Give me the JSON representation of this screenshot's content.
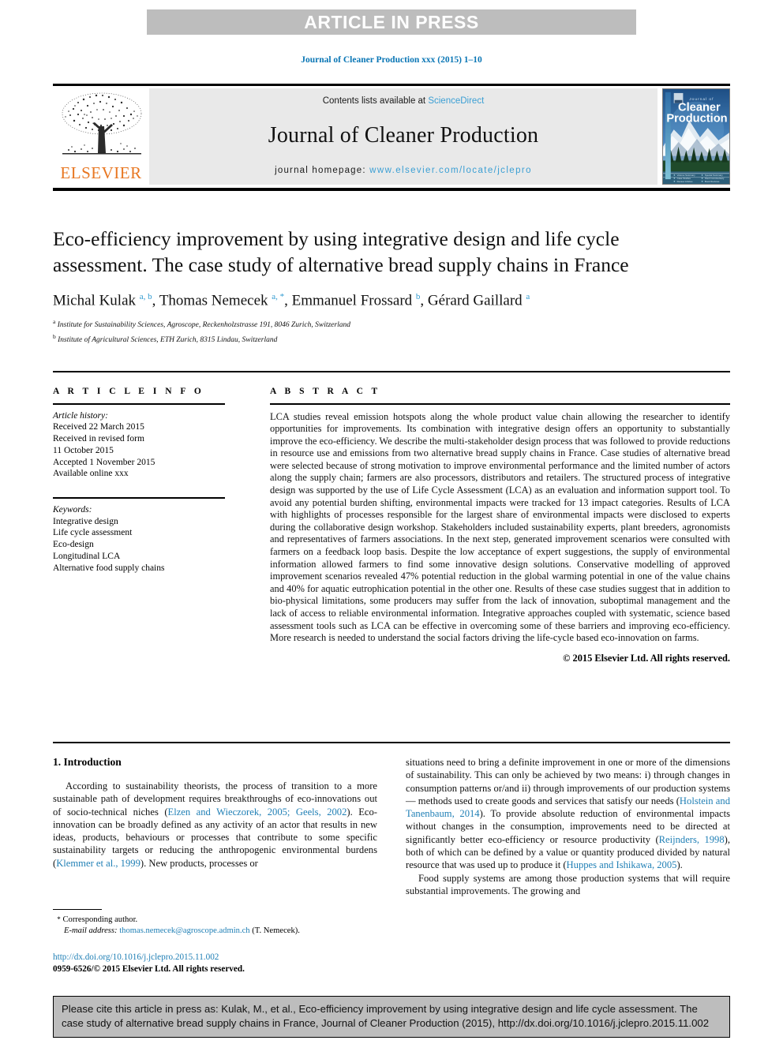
{
  "banner": {
    "text": "ARTICLE IN PRESS"
  },
  "running_head": "Journal of Cleaner Production xxx (2015) 1–10",
  "masthead": {
    "contents_prefix": "Contents lists available at ",
    "sciencedirect": "ScienceDirect",
    "journal_title": "Journal of Cleaner Production",
    "homepage_prefix": "journal homepage: ",
    "homepage_url": "www.elsevier.com/locate/jclepro",
    "publisher_logo_text": "ELSEVIER",
    "cover_title_small": "Journal of",
    "cover_title_line1": "Cleaner",
    "cover_title_line2": "Production",
    "accent_blue": "#3b9fd4",
    "elsevier_orange": "#e87722",
    "banner_grey": "#bdbdbd"
  },
  "article": {
    "title": "Eco-efficiency improvement by using integrative design and life cycle assessment. The case study of alternative bread supply chains in France",
    "authors_html": "Michal Kulak <sup>a, b</sup>, Thomas Nemecek <sup>a, *</sup>, Emmanuel Frossard <sup>b</sup>, Gérard Gaillard <sup>a</sup>",
    "affiliations": [
      "Institute for Sustainability Sciences, Agroscope, Reckenholzstrasse 191, 8046 Zurich, Switzerland",
      "Institute of Agricultural Sciences, ETH Zurich, 8315 Lindau, Switzerland"
    ],
    "affiliation_marks": [
      "a",
      "b"
    ]
  },
  "info": {
    "heading": "A R T I C L E  I N F O",
    "history_label": "Article history:",
    "history_lines": [
      "Received 22 March 2015",
      "Received in revised form",
      "11 October 2015",
      "Accepted 1 November 2015",
      "Available online xxx"
    ],
    "keywords_label": "Keywords:",
    "keywords": [
      "Integrative design",
      "Life cycle assessment",
      "Eco-design",
      "Longitudinal LCA",
      "Alternative food supply chains"
    ]
  },
  "abstract": {
    "heading": "A B S T R A C T",
    "text": "LCA studies reveal emission hotspots along the whole product value chain allowing the researcher to identify opportunities for improvements. Its combination with integrative design offers an opportunity to substantially improve the eco-efficiency. We describe the multi-stakeholder design process that was followed to provide reductions in resource use and emissions from two alternative bread supply chains in France. Case studies of alternative bread were selected because of strong motivation to improve environmental performance and the limited number of actors along the supply chain; farmers are also processors, distributors and retailers. The structured process of integrative design was supported by the use of Life Cycle Assessment (LCA) as an evaluation and information support tool. To avoid any potential burden shifting, environmental impacts were tracked for 13 impact categories. Results of LCA with highlights of processes responsible for the largest share of environmental impacts were disclosed to experts during the collaborative design workshop. Stakeholders included sustainability experts, plant breeders, agronomists and representatives of farmers associations. In the next step, generated improvement scenarios were consulted with farmers on a feedback loop basis. Despite the low acceptance of expert suggestions, the supply of environmental information allowed farmers to find some innovative design solutions. Conservative modelling of approved improvement scenarios revealed 47% potential reduction in the global warming potential in one of the value chains and 40% for aquatic eutrophication potential in the other one. Results of these case studies suggest that in addition to bio-physical limitations, some producers may suffer from the lack of innovation, suboptimal management and the lack of access to reliable environmental information. Integrative approaches coupled with systematic, science based assessment tools such as LCA can be effective in overcoming some of these barriers and improving eco-efficiency. More research is needed to understand the social factors driving the life-cycle based eco-innovation on farms.",
    "copyright": "© 2015 Elsevier Ltd. All rights reserved."
  },
  "introduction": {
    "heading": "1. Introduction",
    "left_paragraph_1_html": "According to sustainability theorists, the process of transition to a more sustainable path of development requires breakthroughs of eco-innovations out of socio-technical niches (<span class=\"ref\">Elzen and Wieczorek, 2005; Geels, 2002</span>). Eco-innovation can be broadly defined as any activity of an actor that results in new ideas, products, behaviours or processes that contribute to some specific sustainability targets or reducing the anthropogenic environmental burdens (<span class=\"ref\">Klemmer et al., 1999</span>). New products, processes or",
    "right_paragraph_1_html": "situations need to bring a definite improvement in one or more of the dimensions of sustainability. This can only be achieved by two means: i) through changes in consumption patterns or/and ii) through improvements of our production systems — methods used to create goods and services that satisfy our needs (<span class=\"ref\">Holstein and Tanenbaum, 2014</span>). To provide absolute reduction of environmental impacts without changes in the consumption, improvements need to be directed at significantly better eco-efficiency or resource productivity (<span class=\"ref\">Reijnders, 1998</span>), both of which can be defined by a value or quantity produced divided by natural resource that was used up to produce it (<span class=\"ref\">Huppes and Ishikawa, 2005</span>).",
    "right_paragraph_2_html": "Food supply systems are among those production systems that will require substantial improvements. The growing and"
  },
  "footnote": {
    "corresponding_marker": "*",
    "corresponding_text": "Corresponding author.",
    "email_label": "E-mail address:",
    "email": "thomas.nemecek@agroscope.admin.ch",
    "email_suffix": "(T. Nemecek)."
  },
  "doi": {
    "url": "http://dx.doi.org/10.1016/j.jclepro.2015.11.002",
    "issn_line": "0959-6526/© 2015 Elsevier Ltd. All rights reserved."
  },
  "citation_box": {
    "text": "Please cite this article in press as: Kulak, M., et al., Eco-efficiency improvement by using integrative design and life cycle assessment. The case study of alternative bread supply chains in France, Journal of Cleaner Production (2015), http://dx.doi.org/10.1016/j.jclepro.2015.11.002"
  }
}
